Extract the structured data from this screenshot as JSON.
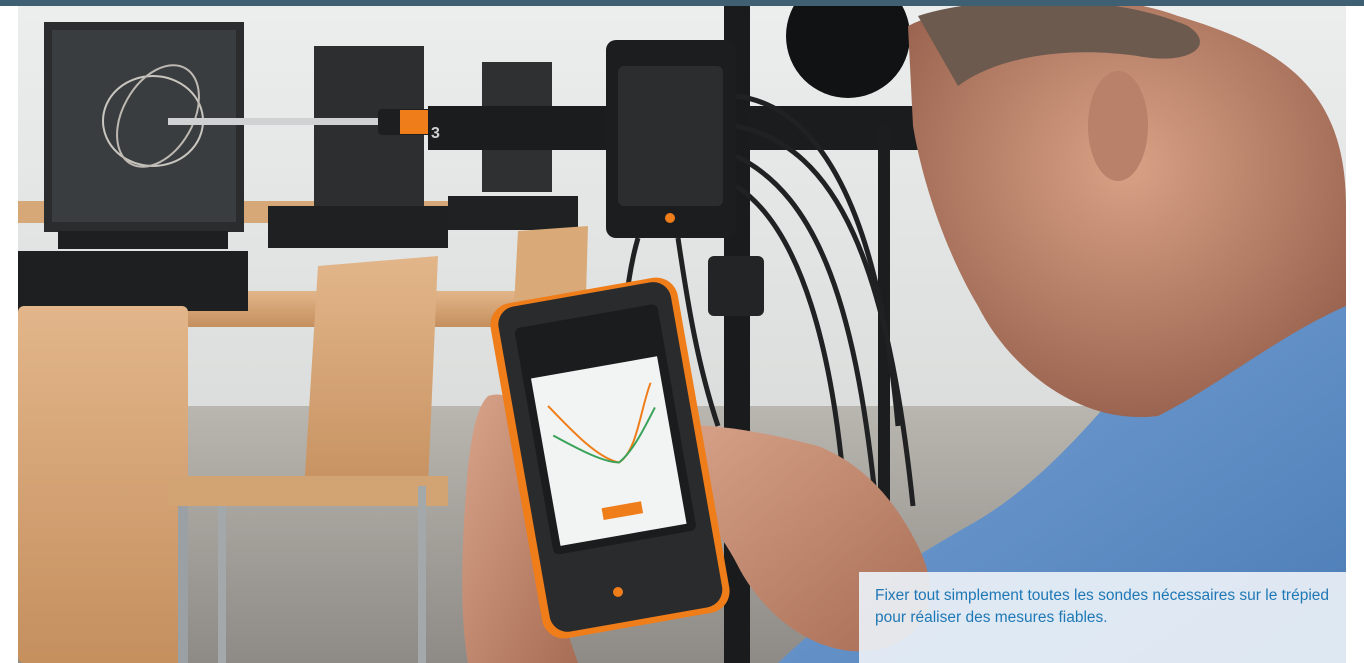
{
  "caption": {
    "text": "Fixer tout simplement toutes les sondes nécessaires sur le trépied pour réaliser des mesures fiables."
  },
  "photo": {
    "subject": "person-using-handheld-measuring-instrument-on-tripod",
    "colors": {
      "frame_band": "#3f5f73",
      "caption_text": "#1f78b6",
      "caption_bg": "#e9f0f6",
      "device_orange": "#ef7d1a",
      "shirt_blue": "#5e8fc8"
    }
  }
}
